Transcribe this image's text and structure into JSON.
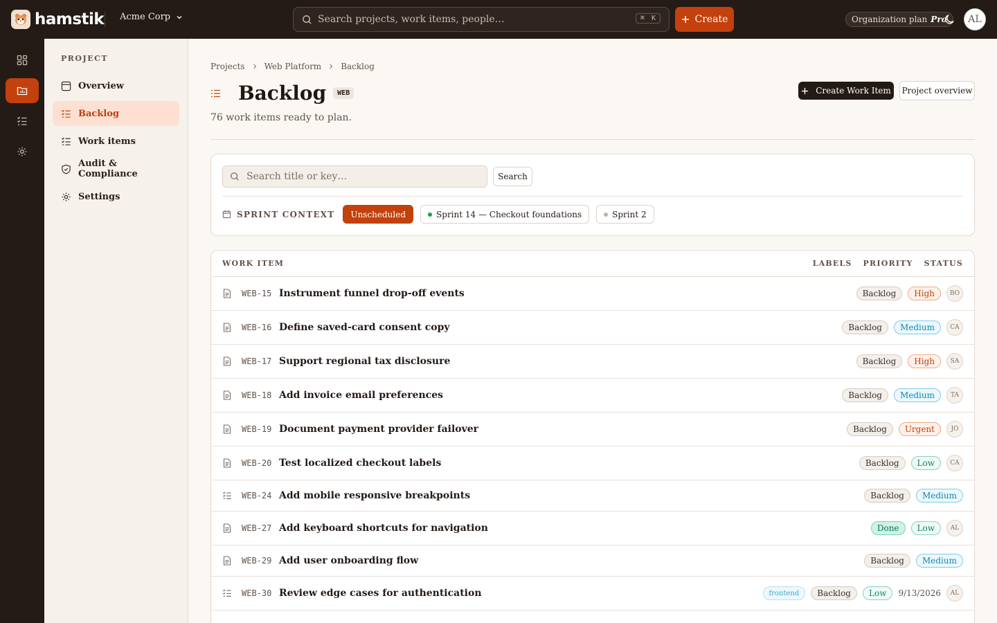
{
  "topbar": {
    "brand": "hamstik",
    "org": "Acme Corp",
    "search_placeholder": "Search projects, work items, people…",
    "shortcut_mod": "⌘",
    "shortcut_key": "K",
    "create_label": "Create",
    "plan_label": "Organization plan",
    "plan_tier": "Pro",
    "user_initials": "AL"
  },
  "sidebar": {
    "heading": "PROJECT",
    "items": [
      {
        "label": "Overview"
      },
      {
        "label": "Backlog"
      },
      {
        "label": "Work items"
      },
      {
        "label": "Audit & Compliance"
      },
      {
        "label": "Settings"
      }
    ]
  },
  "breadcrumb": [
    "Projects",
    "Web Platform",
    "Backlog"
  ],
  "page": {
    "title": "Backlog",
    "key": "WEB",
    "subtitle": "76 work items ready to plan.",
    "create_work_item": "Create Work Item",
    "project_overview": "Project overview"
  },
  "filters": {
    "search_placeholder": "Search title or key…",
    "search_button": "Search",
    "sprint_context_label": "SPRINT CONTEXT",
    "chips": [
      {
        "label": "Unscheduled",
        "active": true
      },
      {
        "label": "Sprint 14 — Checkout foundations",
        "dot_color": "#16a34a"
      },
      {
        "label": "Sprint 2",
        "dot_color": "#bdb3aa"
      }
    ]
  },
  "table": {
    "headers": {
      "work_item": "WORK ITEM",
      "labels": "LABELS",
      "priority": "PRIORITY",
      "status": "STATUS"
    },
    "rows": [
      {
        "key": "WEB-15",
        "title": "Instrument funnel drop-off events",
        "status": "Backlog",
        "priority": "High",
        "assignee": "BO",
        "icon": "doc-icon"
      },
      {
        "key": "WEB-16",
        "title": "Define saved-card consent copy",
        "status": "Backlog",
        "priority": "Medium",
        "assignee": "CA",
        "icon": "doc-icon"
      },
      {
        "key": "WEB-17",
        "title": "Support regional tax disclosure",
        "status": "Backlog",
        "priority": "High",
        "assignee": "SA",
        "icon": "doc-icon"
      },
      {
        "key": "WEB-18",
        "title": "Add invoice email preferences",
        "status": "Backlog",
        "priority": "Medium",
        "assignee": "TA",
        "icon": "doc-icon"
      },
      {
        "key": "WEB-19",
        "title": "Document payment provider failover",
        "status": "Backlog",
        "priority": "Urgent",
        "assignee": "JO",
        "icon": "doc-icon"
      },
      {
        "key": "WEB-20",
        "title": "Test localized checkout labels",
        "status": "Backlog",
        "priority": "Low",
        "assignee": "CA",
        "icon": "doc-icon"
      },
      {
        "key": "WEB-24",
        "title": "Add mobile responsive breakpoints",
        "status": "Backlog",
        "priority": "Medium",
        "assignee": "",
        "icon": "checklist-icon"
      },
      {
        "key": "WEB-27",
        "title": "Add keyboard shortcuts for navigation",
        "status": "Done",
        "priority": "Low",
        "assignee": "AL",
        "icon": "doc-icon"
      },
      {
        "key": "WEB-29",
        "title": "Add user onboarding flow",
        "status": "Backlog",
        "priority": "Medium",
        "assignee": "",
        "icon": "doc-icon"
      },
      {
        "key": "WEB-30",
        "title": "Review edge cases for authentication",
        "label": "frontend",
        "status": "Backlog",
        "priority": "Low",
        "due": "9/13/2026",
        "assignee": "AL",
        "icon": "checklist-icon"
      }
    ]
  }
}
